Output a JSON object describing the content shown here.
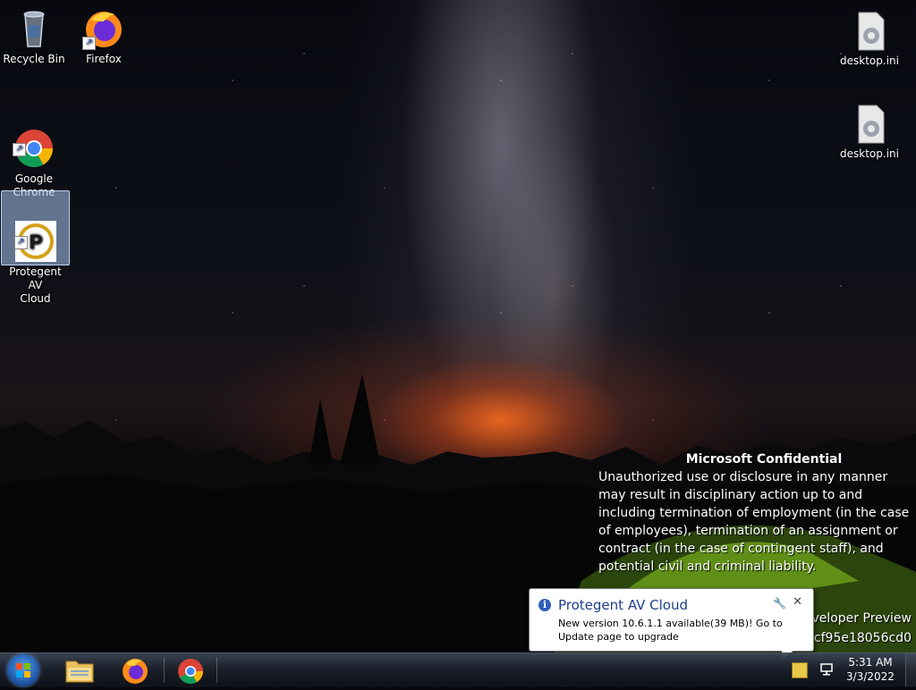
{
  "desktop": {
    "icons": [
      {
        "label": "Recycle Bin"
      },
      {
        "label": "Firefox"
      },
      {
        "label": "Google\nChrome"
      },
      {
        "label": "Protegent  AV\nCloud"
      },
      {
        "label": "desktop.ini"
      },
      {
        "label": "desktop.ini"
      }
    ]
  },
  "watermark": {
    "title": "Microsoft Confidential",
    "body": "Unauthorized use or disclosure in any manner may result in disciplinary action up to and including termination of employment (in the case of employees), termination of an assignment or contract (in the case of contingent staff), and potential civil and criminal liability.",
    "build_line1": "eveloper Preview",
    "build_line2": "9cf95e18056cd0"
  },
  "notification": {
    "title": "Protegent AV Cloud",
    "message": "New version 10.6.1.1 available(39 MB)! Go to Update page to upgrade",
    "info_icon": "info-icon",
    "close_glyph": "✕",
    "pin_glyph": "🔧"
  },
  "taskbar": {
    "pinned": [
      {
        "name": "file-explorer",
        "icon": "folder-icon"
      },
      {
        "name": "firefox",
        "icon": "firefox-icon"
      },
      {
        "name": "chrome",
        "icon": "chrome-icon"
      }
    ],
    "clock": {
      "time": "5:31 AM",
      "date": "3/3/2022"
    }
  },
  "colors": {
    "notification_title": "#1e3e8c",
    "taskbar": "#1a1f28"
  }
}
